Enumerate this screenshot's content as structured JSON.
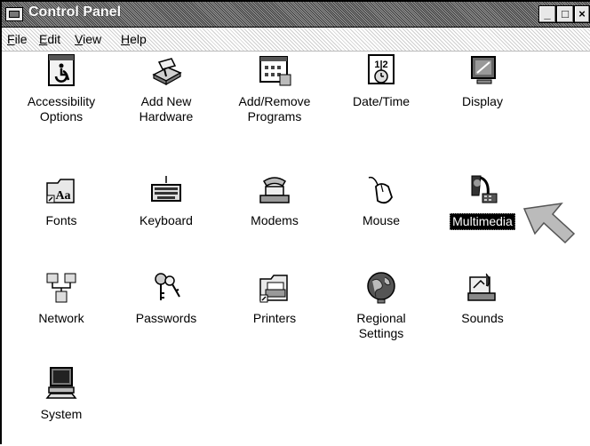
{
  "window": {
    "title": "Control Panel",
    "buttons": {
      "minimize": "_",
      "maximize": "□",
      "close": "×"
    }
  },
  "menu": [
    {
      "label": "File",
      "mnemonic": "F"
    },
    {
      "label": "Edit",
      "mnemonic": "E"
    },
    {
      "label": "View",
      "mnemonic": "V"
    },
    {
      "label": "Help",
      "mnemonic": "H"
    }
  ],
  "items": [
    {
      "label": "Accessibility\nOptions",
      "icon": "accessibility-icon"
    },
    {
      "label": "Add New\nHardware",
      "icon": "add-hardware-icon"
    },
    {
      "label": "Add/Remove\nPrograms",
      "icon": "add-remove-programs-icon"
    },
    {
      "label": "Date/Time",
      "icon": "calendar-clock-icon"
    },
    {
      "label": "Display",
      "icon": "display-icon"
    },
    {
      "label": "Fonts",
      "icon": "fonts-folder-icon"
    },
    {
      "label": "Keyboard",
      "icon": "keyboard-icon"
    },
    {
      "label": "Modems",
      "icon": "modem-phone-icon"
    },
    {
      "label": "Mouse",
      "icon": "mouse-icon"
    },
    {
      "label": "Multimedia",
      "icon": "multimedia-icon",
      "selected": true
    },
    {
      "label": "Network",
      "icon": "network-icon"
    },
    {
      "label": "Passwords",
      "icon": "keys-icon"
    },
    {
      "label": "Printers",
      "icon": "printers-folder-icon"
    },
    {
      "label": "Regional\nSettings",
      "icon": "globe-icon"
    },
    {
      "label": "Sounds",
      "icon": "sounds-icon"
    },
    {
      "label": "System",
      "icon": "computer-icon"
    }
  ],
  "cursor": {
    "icon": "arrow-cursor-icon"
  }
}
